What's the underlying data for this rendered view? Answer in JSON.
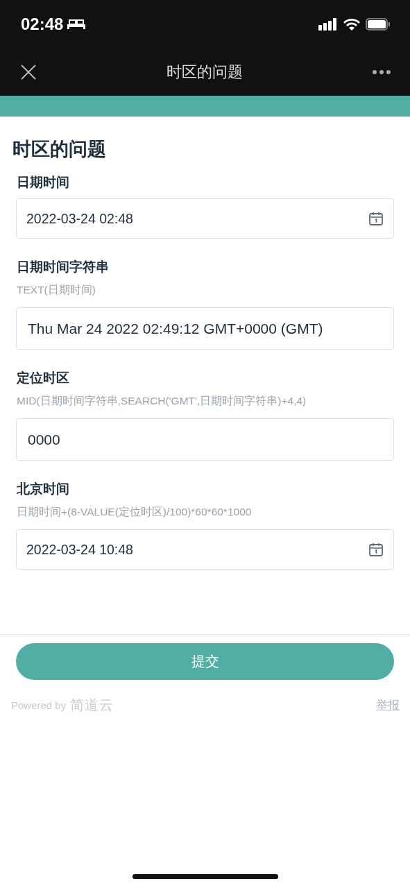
{
  "status_bar": {
    "time": "02:48"
  },
  "nav_bar": {
    "title": "时区的问题"
  },
  "form": {
    "title": "时区的问题",
    "fields": [
      {
        "label": "日期时间",
        "kind": "date",
        "value": "2022-03-24 02:48"
      },
      {
        "label": "日期时间字符串",
        "kind": "text",
        "formula": "TEXT(日期时间)",
        "value": "Thu Mar 24 2022 02:49:12 GMT+0000 (GMT)"
      },
      {
        "label": "定位时区",
        "kind": "text",
        "formula": "MID(日期时间字符串,SEARCH('GMT',日期时间字符串)+4,4)",
        "value": "0000"
      },
      {
        "label": "北京时间",
        "kind": "date",
        "formula": "日期时间+(8-VALUE(定位时区)/100)*60*60*1000",
        "value": "2022-03-24 10:48"
      }
    ],
    "submit": "提交"
  },
  "footer": {
    "powered_by": "Powered by",
    "brand": "简道云",
    "report": "举报"
  }
}
